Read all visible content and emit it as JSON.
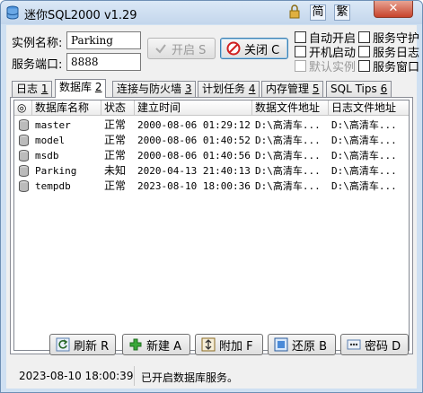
{
  "window": {
    "title": "迷你SQL2000 v1.29",
    "lang_simplified": "简",
    "lang_traditional": "繁",
    "close": "✕"
  },
  "form": {
    "instance_label": "实例名称:",
    "instance_value": "Parking",
    "port_label": "服务端口:",
    "port_value": "8888"
  },
  "buttons": {
    "start": "开启 S",
    "stop": "关闭 C"
  },
  "options": {
    "auto_start": "自动开启",
    "boot_start": "开机启动",
    "default_instance": "默认实例",
    "service_guard": "服务守护",
    "service_log": "服务日志",
    "service_window": "服务窗口"
  },
  "tabs": [
    {
      "label": "日志",
      "key": "1"
    },
    {
      "label": "数据库",
      "key": "2"
    },
    {
      "label": "连接与防火墙",
      "key": "3"
    },
    {
      "label": "计划任务",
      "key": "4"
    },
    {
      "label": "内存管理",
      "key": "5"
    },
    {
      "label": "SQL Tips",
      "key": "6"
    }
  ],
  "grid": {
    "headers": [
      "◎",
      "数据库名称",
      "状态",
      "建立时间",
      "数据文件地址",
      "日志文件地址"
    ],
    "rows": [
      {
        "name": "master",
        "status": "正常",
        "created": "2000-08-06 01:29:12",
        "data": "D:\\高清车...",
        "log": "D:\\高清车..."
      },
      {
        "name": "model",
        "status": "正常",
        "created": "2000-08-06 01:40:52",
        "data": "D:\\高清车...",
        "log": "D:\\高清车..."
      },
      {
        "name": "msdb",
        "status": "正常",
        "created": "2000-08-06 01:40:56",
        "data": "D:\\高清车...",
        "log": "D:\\高清车..."
      },
      {
        "name": "Parking",
        "status": "未知",
        "created": "2020-04-13 21:40:13",
        "data": "D:\\高清车...",
        "log": "D:\\高清车..."
      },
      {
        "name": "tempdb",
        "status": "正常",
        "created": "2023-08-10 18:00:36",
        "data": "D:\\高清车...",
        "log": "D:\\高清车..."
      }
    ]
  },
  "actions": {
    "refresh": "刷新 R",
    "new": "新建 A",
    "attach": "附加 F",
    "restore": "还原 B",
    "password": "密码 D"
  },
  "status": {
    "time": "2023-08-10 18:00:39",
    "message": "已开启数据库服务。"
  }
}
